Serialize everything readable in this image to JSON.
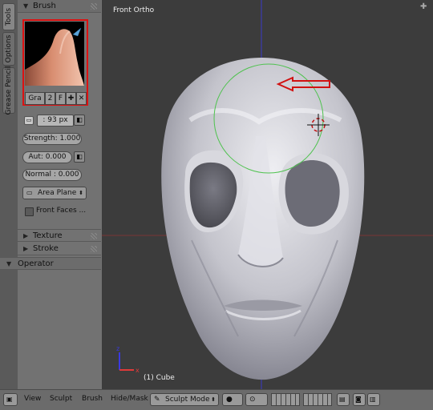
{
  "tabs": [
    "Tools",
    "Options",
    "Grease Pencil"
  ],
  "brush_panel": {
    "title": "Brush",
    "row_buttons": [
      "Gra",
      "2",
      "F"
    ],
    "add_symbol": "✚",
    "close_symbol": "✕"
  },
  "fields": {
    "radius": ": 93 px",
    "strength": "Strength: 1.000",
    "autosmooth": "Aut: 0.000",
    "normal": "Normal : 0.000",
    "plane": "Area Plane",
    "front_faces": "Front Faces ..."
  },
  "panels": {
    "texture": "Texture",
    "stroke": "Stroke",
    "operator": "Operator"
  },
  "viewport": {
    "view_label": "Front Ortho",
    "object_label": "(1) Cube"
  },
  "header": {
    "menu_view": "View",
    "menu_sculpt": "Sculpt",
    "menu_brush": "Brush",
    "menu_hidemask": "Hide/Mask",
    "mode": "Sculpt Mode"
  },
  "colors": {
    "highlight_red": "#d11111",
    "viewport_bg": "#3c3c3c",
    "panel_bg": "#727272"
  }
}
